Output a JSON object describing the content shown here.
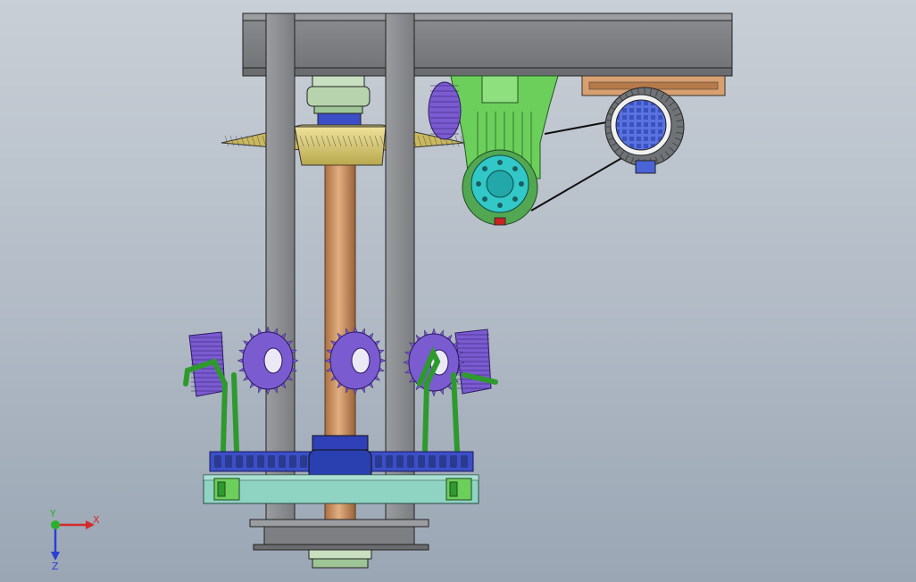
{
  "viewport": {
    "background_top": "#c9cfd6",
    "background_bottom": "#9aa6b4"
  },
  "model": {
    "parts": {
      "frame_color": "#7d7f82",
      "column_color": "#8a8c8f",
      "shaft_color": "#c9905e",
      "gearbox_color": "#6ccf5c",
      "flange_color": "#33c8c8",
      "motor_color": "#4a63d6",
      "bevel_gear_color": "#7a5bd0",
      "crown_gear_color": "#e0d27a",
      "hub_color": "#2a3fb0",
      "base_plate_color": "#8fd3c3"
    }
  },
  "triad": {
    "x_label": "X",
    "y_label": "Y",
    "z_label": "Z",
    "x_color": "#d42a2a",
    "y_color": "#2ab02a",
    "z_color": "#2a3fd4"
  }
}
